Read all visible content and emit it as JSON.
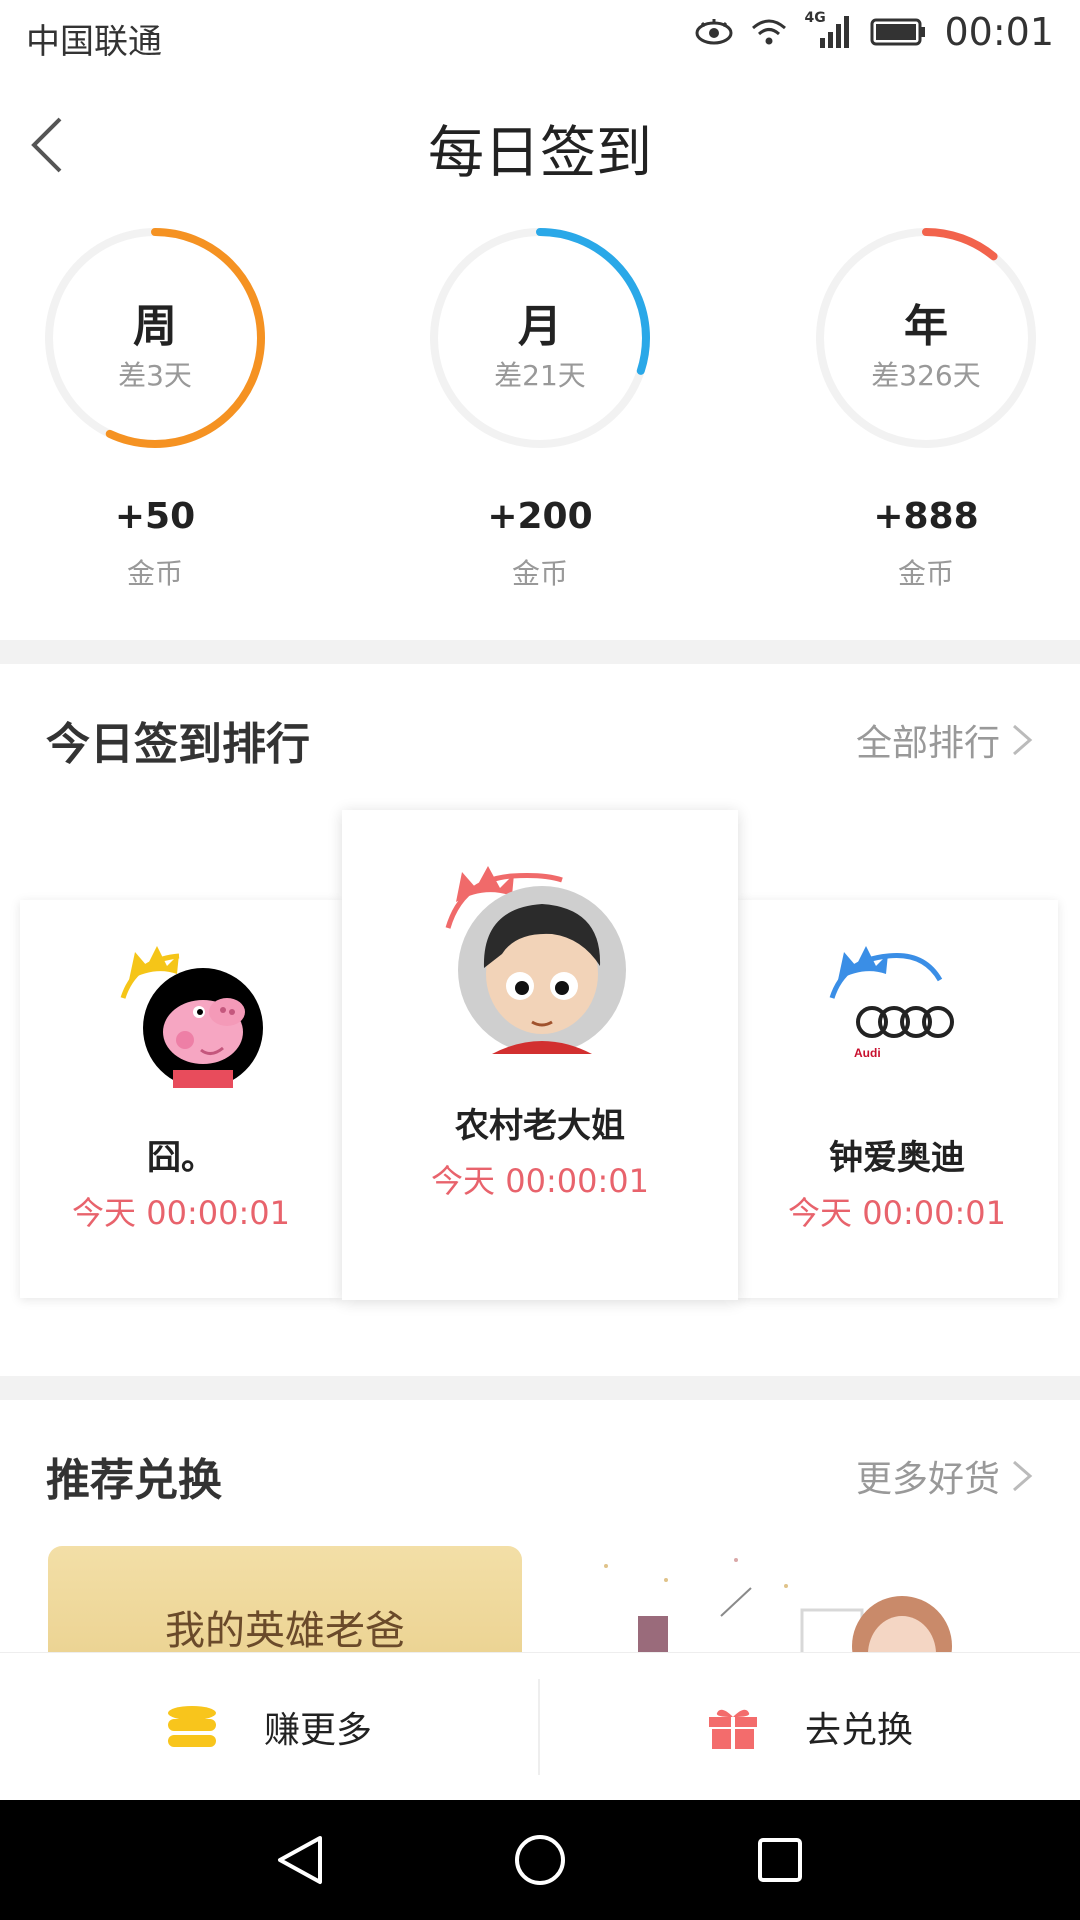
{
  "status_bar": {
    "carrier": "中国联通",
    "network": "4G",
    "time": "00:01"
  },
  "header": {
    "title": "每日签到"
  },
  "rings": [
    {
      "label": "周",
      "sub": "差3天",
      "points": "+50",
      "unit": "金币",
      "progress": 0.57,
      "color": "#f59222"
    },
    {
      "label": "月",
      "sub": "差21天",
      "points": "+200",
      "unit": "金币",
      "progress": 0.3,
      "color": "#2aa8e8"
    },
    {
      "label": "年",
      "sub": "差326天",
      "points": "+888",
      "unit": "金币",
      "progress": 0.11,
      "color": "#f2634c"
    }
  ],
  "ranking": {
    "title": "今日签到排行",
    "link": "全部排行",
    "cards": [
      {
        "name": "囧。",
        "time": "今天 00:00:01",
        "crown_color": "#f5c518"
      },
      {
        "name": "农村老大姐",
        "time": "今天 00:00:01",
        "crown_color": "#f06a6a"
      },
      {
        "name": "钟爱奥迪",
        "time": "今天 00:00:01",
        "crown_color": "#3a8ee6",
        "avatar_text": "Audi"
      }
    ]
  },
  "exchange": {
    "title": "推荐兑换",
    "link": "更多好货",
    "item1_text": "我的英雄老爸"
  },
  "bottom_bar": {
    "earn_label": "赚更多",
    "redeem_label": "去兑换",
    "earn_color": "#f8c51c",
    "redeem_color": "#f36c6c"
  }
}
